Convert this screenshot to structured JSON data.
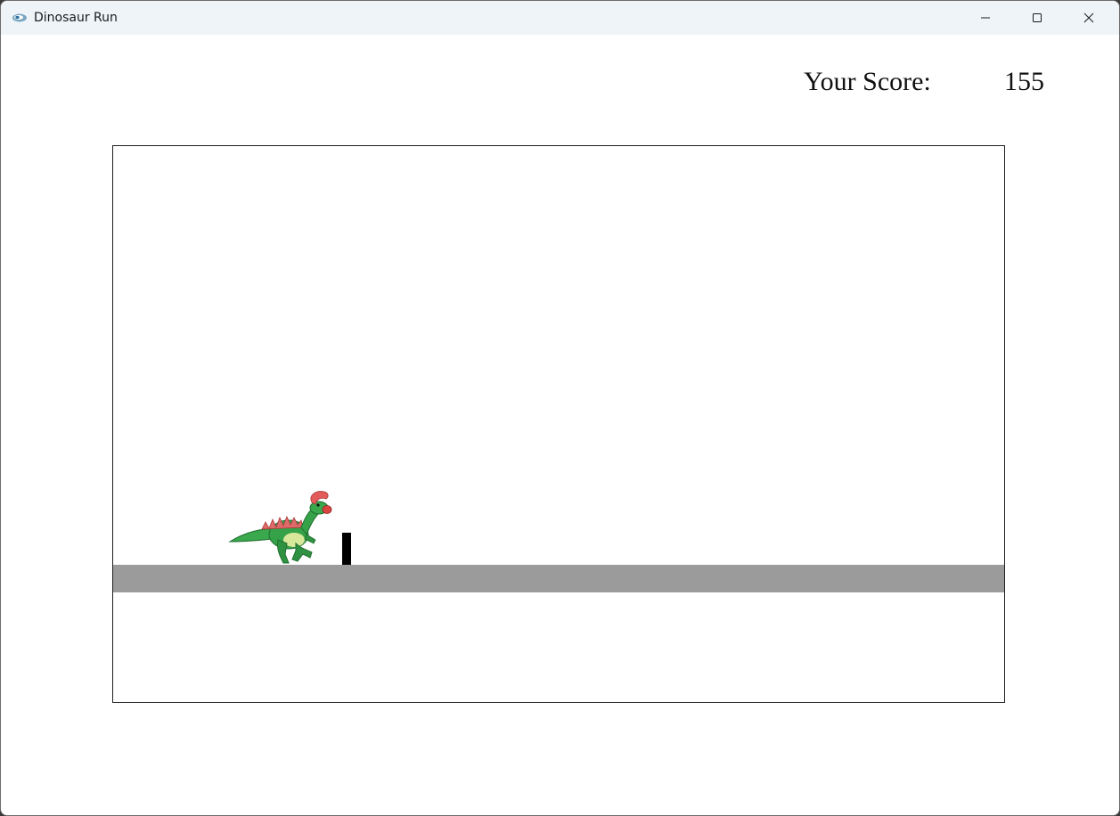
{
  "window": {
    "title": "Dinosaur Run"
  },
  "caption_buttons": {
    "minimize": "minimize-icon",
    "maximize": "maximize-icon",
    "close": "close-icon"
  },
  "hud": {
    "score_label": "Your Score:",
    "score_value": "155"
  },
  "game": {
    "player": "dinosaur-sprite",
    "obstacle": "cactus-block",
    "colors": {
      "ground": "#9b9b9b",
      "obstacle": "#000000",
      "dino_body": "#2e9e43",
      "dino_crest": "#d9534f"
    }
  }
}
